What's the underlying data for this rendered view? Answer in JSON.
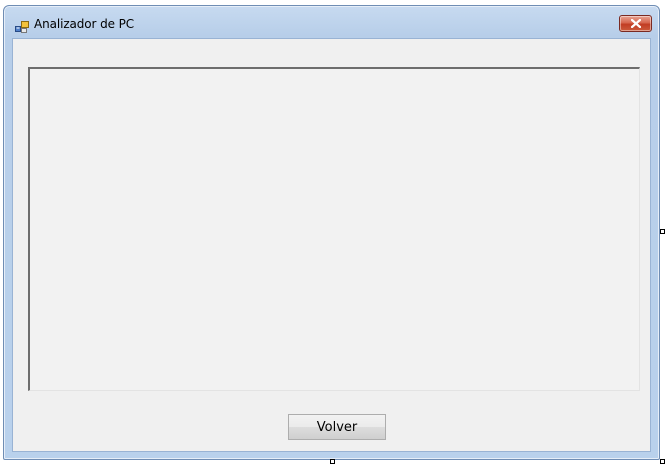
{
  "window": {
    "title": "Analizador de PC",
    "app_icon": "app-form-icon",
    "close_icon": "close-icon"
  },
  "content": {
    "text_panel_value": "",
    "volver_label": "Volver"
  },
  "designer": {
    "handles": [
      "resize-handle-right",
      "resize-handle-bottom",
      "resize-handle-corner"
    ]
  },
  "colors": {
    "titlebar": "#b9d1ec",
    "client_background": "#f0f0f0",
    "close_button": "#c13d24"
  }
}
